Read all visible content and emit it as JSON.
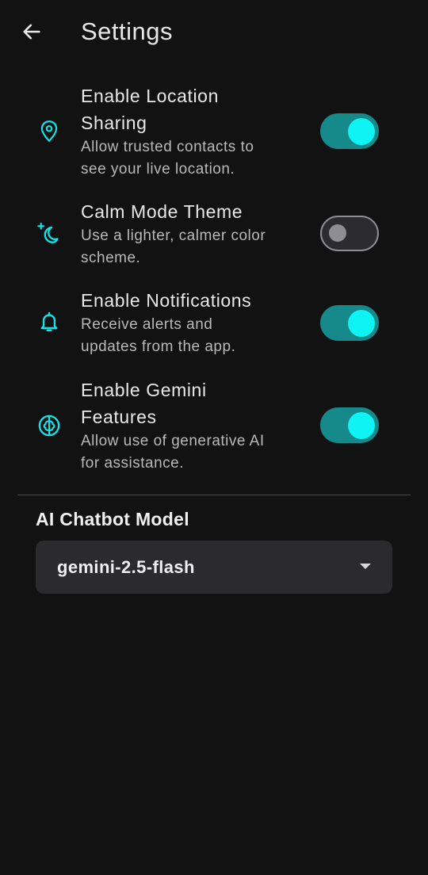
{
  "header": {
    "title": "Settings",
    "back_icon": "arrow-left-icon"
  },
  "settings": [
    {
      "icon": "location-pin-icon",
      "title": "Enable Location Sharing",
      "title_lines": [
        "Enable Location",
        "Sharing"
      ],
      "description": "Allow trusted contacts to see your live location.",
      "desc_lines": [
        "Allow trusted contacts to",
        "see your live location."
      ],
      "enabled": true
    },
    {
      "icon": "moon-sparkle-icon",
      "title": "Calm Mode Theme",
      "title_lines": [
        "Calm Mode Theme"
      ],
      "description": "Use a lighter, calmer color scheme.",
      "desc_lines": [
        "Use a lighter, calmer color",
        "scheme."
      ],
      "enabled": false
    },
    {
      "icon": "bell-icon",
      "title": "Enable Notifications",
      "title_lines": [
        "Enable Notifications"
      ],
      "description": "Receive alerts and updates from the app.",
      "desc_lines": [
        "Receive alerts and",
        "updates from the app."
      ],
      "enabled": true
    },
    {
      "icon": "brain-icon",
      "title": "Enable Gemini Features",
      "title_lines": [
        "Enable Gemini",
        "Features"
      ],
      "description": "Allow use of generative AI for assistance.",
      "desc_lines": [
        "Allow use of generative AI",
        "for assistance."
      ],
      "enabled": true
    }
  ],
  "model_section": {
    "label": "AI Chatbot Model",
    "selected": "gemini-2.5-flash",
    "arrow_icon": "dropdown-arrow-icon"
  },
  "colors": {
    "background": "#121212",
    "accent": "#10f3f5",
    "switch_track_on": "#16898a",
    "switch_track_off": "#2c2c30",
    "dropdown_bg": "#2b2b2d"
  }
}
